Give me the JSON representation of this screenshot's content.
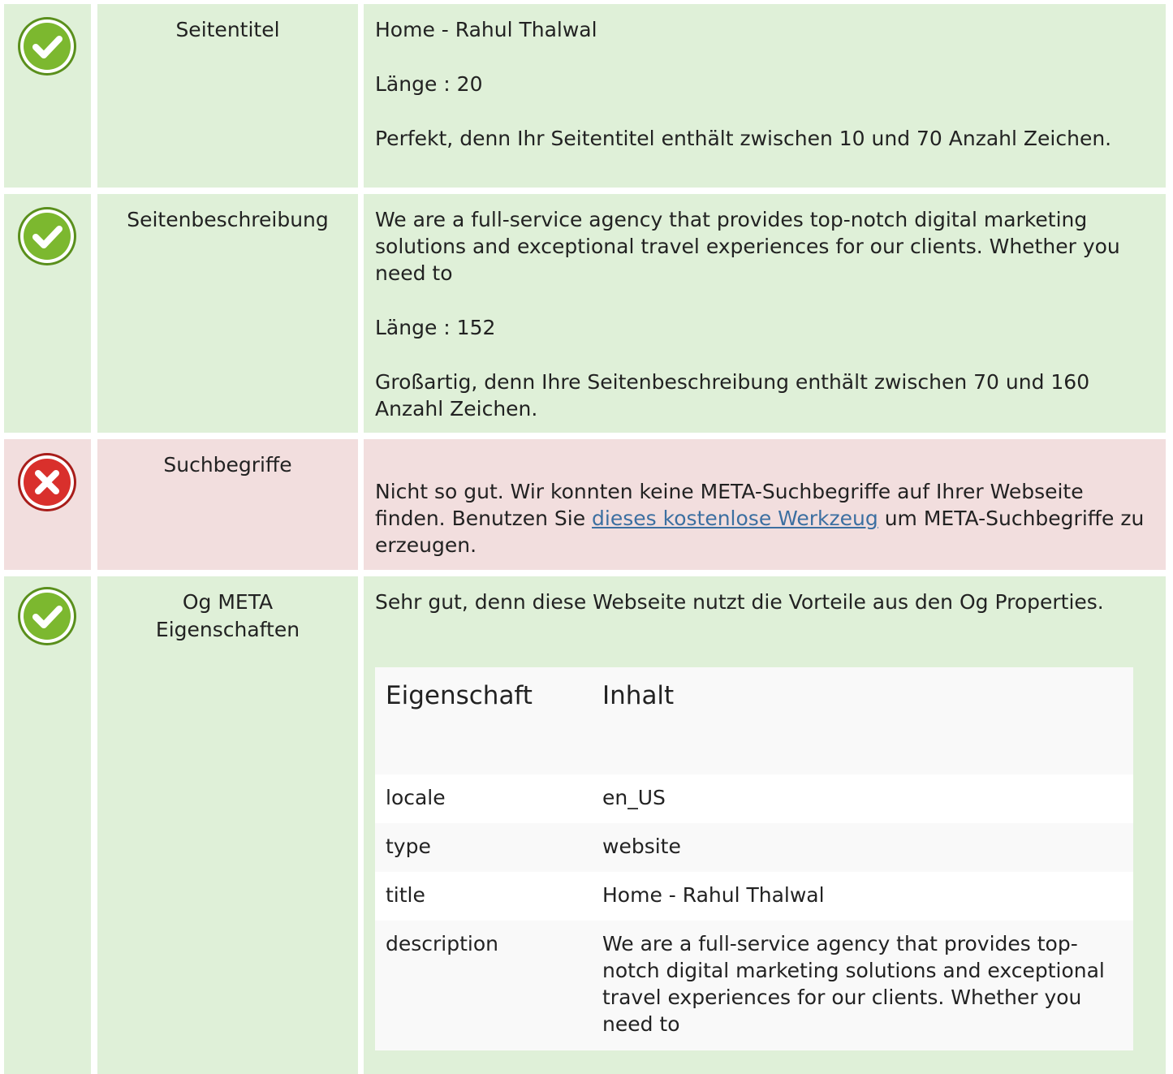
{
  "colors": {
    "ok_background": "#dff0d8",
    "bad_background": "#f2dede",
    "ok_icon": "#7cb82f",
    "bad_icon": "#d9302c",
    "link": "#3c6fa1"
  },
  "rows": [
    {
      "status": "ok",
      "icon": "check-icon",
      "label": "Seitentitel",
      "value": "Home - Rahul Thalwal",
      "length": "Länge : 20",
      "message": "Perfekt, denn Ihr Seitentitel enthält zwischen 10 und 70 Anzahl Zeichen."
    },
    {
      "status": "ok",
      "icon": "check-icon",
      "label": "Seitenbeschreibung",
      "value": "We are a full-service agency that provides top-notch digital marketing solutions and exceptional travel experiences for our clients. Whether you need to",
      "length": "Länge : 152",
      "message": "Großartig, denn Ihre Seitenbeschreibung enthält zwischen 70 und 160 Anzahl Zeichen."
    },
    {
      "status": "bad",
      "icon": "cross-icon",
      "label": "Suchbegriffe",
      "message_before": "Nicht so gut. Wir konnten keine META-Suchbegriffe auf Ihrer Webseite finden. Benutzen Sie ",
      "link_text": "dieses kostenlose Werkzeug",
      "message_after": " um META-Suchbegriffe zu erzeugen."
    },
    {
      "status": "ok",
      "icon": "check-icon",
      "label": "Og META Eigenschaften",
      "message": "Sehr gut, denn diese Webseite nutzt die Vorteile aus den Og Properties.",
      "table": {
        "header_property": "Eigenschaft",
        "header_content": "Inhalt",
        "rows": [
          {
            "property": "locale",
            "content": "en_US"
          },
          {
            "property": "type",
            "content": "website"
          },
          {
            "property": "title",
            "content": "Home - Rahul Thalwal"
          },
          {
            "property": "description",
            "content": "We are a full-service agency that provides top-notch digital marketing solutions and exceptional travel experiences for our clients. Whether you need to"
          }
        ]
      }
    }
  ]
}
